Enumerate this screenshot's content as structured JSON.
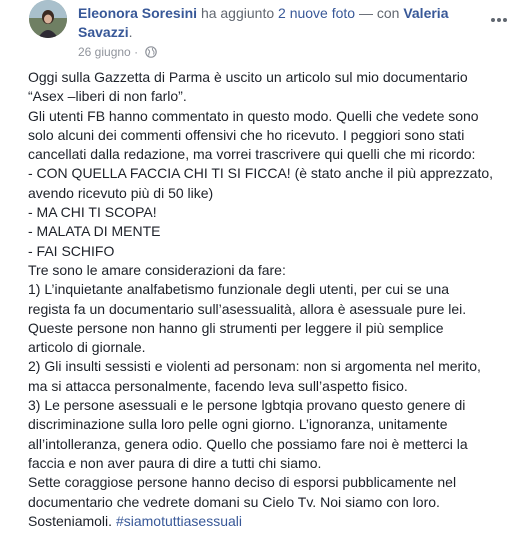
{
  "post": {
    "author": "Eleonora Soresini",
    "action": "ha aggiunto",
    "photos_link": "2 nuove foto",
    "with_sep": "— con",
    "tagged_user": "Valeria Savazzi",
    "period": ".",
    "date": "26 giugno",
    "date_sep": "·",
    "privacy_icon": "globe-icon",
    "more_icon": "more-options-icon",
    "lines": [
      "Oggi sulla Gazzetta di Parma è uscito un articolo sul mio documentario",
      "“Asex –liberi di non farlo”.",
      "Gli utenti FB hanno commentato in questo modo. Quelli che vedete sono",
      "solo alcuni dei commenti offensivi che ho ricevuto. I peggiori sono stati",
      "cancellati dalla redazione, ma vorrei trascrivere qui quelli che mi ricordo:",
      "- CON QUELLA FACCIA CHI TI SI FICCA! (è stato anche il più apprezzato,",
      "avendo ricevuto più di 50 like)",
      "- MA CHI TI SCOPA!",
      "- MALATA DI MENTE",
      "- FAI SCHIFO",
      "Tre sono le amare considerazioni da fare:",
      "1) L’inquietante analfabetismo funzionale degli utenti, per cui se una",
      "regista fa un documentario sull’asessualità, allora è asessuale pure lei.",
      "Queste persone non hanno gli strumenti per leggere il più semplice",
      "articolo di giornale.",
      "2) Gli insulti sessisti e violenti ad personam: non si argomenta nel merito,",
      "ma si attacca personalmente, facendo leva sull’aspetto fisico.",
      "3) Le persone asessuali e le persone lgbtqia provano questo genere di",
      "discriminazione sulla loro pelle ogni giorno. L’ignoranza, unitamente",
      "all’intolleranza, genera odio. Quello che possiamo fare noi è metterci la",
      "faccia e non aver paura di dire a tutti chi siamo.",
      "Sette coraggiose persone hanno deciso di esporsi pubblicamente nel",
      "documentario che vedrete domani su Cielo Tv. Noi siamo con loro."
    ],
    "last_line_text": "Sosteniamoli.",
    "hashtag": "#siamotuttiasessuali",
    "colors": {
      "link": "#385898",
      "text": "#1d2129",
      "meta": "#90949c"
    }
  }
}
